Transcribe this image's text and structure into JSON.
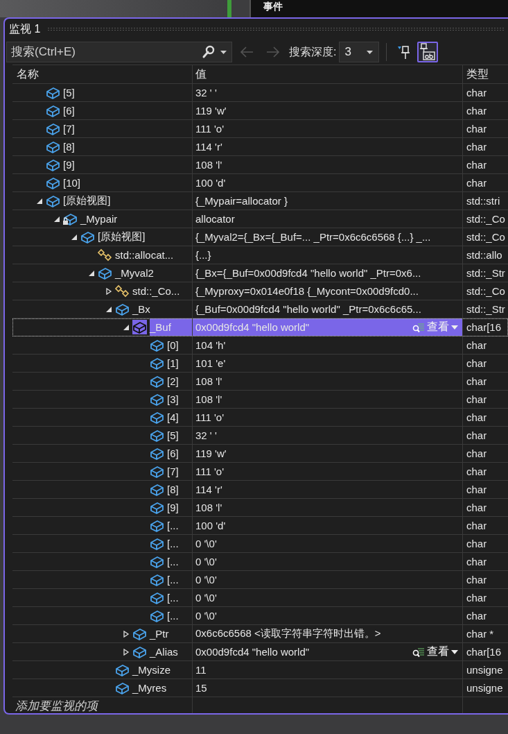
{
  "background_panel": {
    "title": "事件"
  },
  "window": {
    "title": "监视 1"
  },
  "toolbar": {
    "search": {
      "placeholder": "搜索(Ctrl+E)"
    },
    "back_disabled": true,
    "forward_disabled": true,
    "depth_label": "搜索深度:",
    "depth_value": "3",
    "pin_selected": false,
    "visualize_selected": true
  },
  "columns": [
    "名称",
    "值",
    "类型"
  ],
  "rows": [
    {
      "name": "[5]",
      "value": "32 ' '",
      "type": "char",
      "kind": "field",
      "selected": false
    },
    {
      "name": "[6]",
      "value": "119 'w'",
      "type": "char",
      "kind": "field",
      "selected": false
    },
    {
      "name": "[7]",
      "value": "111 'o'",
      "type": "char",
      "kind": "field",
      "selected": false
    },
    {
      "name": "[8]",
      "value": "114 'r'",
      "type": "char",
      "kind": "field",
      "selected": false
    },
    {
      "name": "[9]",
      "value": "108 'l'",
      "type": "char",
      "kind": "field",
      "selected": false
    },
    {
      "name": "[10]",
      "value": "100 'd'",
      "type": "char",
      "kind": "field",
      "selected": false
    },
    {
      "name": "[原始视图]",
      "value": "{_Mypair=allocator }",
      "type": "std::stri",
      "kind": "field",
      "selected": false,
      "expanded": true,
      "children": [
        {
          "name": "_Mypair",
          "value": "allocator",
          "type": "std::_Co",
          "kind": "private_field",
          "selected": false,
          "expanded": true,
          "children": [
            {
              "name": "[原始视图]",
              "value": "{_Myval2={_Bx={_Buf=... _Ptr=0x6c6c6568 {...} _...",
              "type": "std::_Co",
              "kind": "field",
              "selected": false,
              "expanded": true,
              "children": [
                {
                  "name": "std::allocat...",
                  "value": "{...}",
                  "type": "std::allo",
                  "kind": "base_class",
                  "selected": false
                },
                {
                  "name": "_Myval2",
                  "value": "{_Bx={_Buf=0x00d9fcd4 \"hello world\" _Ptr=0x6...",
                  "type": "std::_Str",
                  "kind": "field",
                  "selected": false,
                  "expanded": true,
                  "children": [
                    {
                      "name": "std::_Co...",
                      "value": "{_Myproxy=0x014e0f18 {_Mycont=0x00d9fcd0...",
                      "type": "std::_Co",
                      "kind": "base_class",
                      "selected": false,
                      "expanded": false
                    },
                    {
                      "name": "_Bx",
                      "value": "{_Buf=0x00d9fcd4 \"hello world\" _Ptr=0x6c6c65...",
                      "type": "std::_Str",
                      "kind": "field",
                      "selected": false,
                      "expanded": true,
                      "children": [
                        {
                          "name": "_Buf",
                          "value": "0x00d9fcd4 \"hello world\"",
                          "type": "char[16",
                          "kind": "field",
                          "selected": true,
                          "visualizer": "查看",
                          "expanded": true,
                          "children": [
                            {
                              "name": "[0]",
                              "value": "104 'h'",
                              "type": "char",
                              "kind": "field",
                              "selected": false
                            },
                            {
                              "name": "[1]",
                              "value": "101 'e'",
                              "type": "char",
                              "kind": "field",
                              "selected": false
                            },
                            {
                              "name": "[2]",
                              "value": "108 'l'",
                              "type": "char",
                              "kind": "field",
                              "selected": false
                            },
                            {
                              "name": "[3]",
                              "value": "108 'l'",
                              "type": "char",
                              "kind": "field",
                              "selected": false
                            },
                            {
                              "name": "[4]",
                              "value": "111 'o'",
                              "type": "char",
                              "kind": "field",
                              "selected": false
                            },
                            {
                              "name": "[5]",
                              "value": "32 ' '",
                              "type": "char",
                              "kind": "field",
                              "selected": false
                            },
                            {
                              "name": "[6]",
                              "value": "119 'w'",
                              "type": "char",
                              "kind": "field",
                              "selected": false
                            },
                            {
                              "name": "[7]",
                              "value": "111 'o'",
                              "type": "char",
                              "kind": "field",
                              "selected": false
                            },
                            {
                              "name": "[8]",
                              "value": "114 'r'",
                              "type": "char",
                              "kind": "field",
                              "selected": false
                            },
                            {
                              "name": "[9]",
                              "value": "108 'l'",
                              "type": "char",
                              "kind": "field",
                              "selected": false
                            },
                            {
                              "name": "[...",
                              "value": "100 'd'",
                              "type": "char",
                              "kind": "field",
                              "selected": false
                            },
                            {
                              "name": "[...",
                              "value": "0 '\\0'",
                              "type": "char",
                              "kind": "field",
                              "selected": false
                            },
                            {
                              "name": "[...",
                              "value": "0 '\\0'",
                              "type": "char",
                              "kind": "field",
                              "selected": false
                            },
                            {
                              "name": "[...",
                              "value": "0 '\\0'",
                              "type": "char",
                              "kind": "field",
                              "selected": false
                            },
                            {
                              "name": "[...",
                              "value": "0 '\\0'",
                              "type": "char",
                              "kind": "field",
                              "selected": false
                            },
                            {
                              "name": "[...",
                              "value": "0 '\\0'",
                              "type": "char",
                              "kind": "field",
                              "selected": false
                            }
                          ]
                        },
                        {
                          "name": "_Ptr",
                          "value": "0x6c6c6568 <读取字符串字符时出错。>",
                          "type": "char *",
                          "kind": "field",
                          "selected": false,
                          "expanded": false
                        },
                        {
                          "name": "_Alias",
                          "value": "0x00d9fcd4 \"hello world\"",
                          "type": "char[16",
                          "kind": "field",
                          "selected": false,
                          "visualizer": "查看",
                          "expanded": false
                        }
                      ]
                    },
                    {
                      "name": "_Mysize",
                      "value": "11",
                      "type": "unsigne",
                      "kind": "field",
                      "selected": false
                    },
                    {
                      "name": "_Myres",
                      "value": "15",
                      "type": "unsigne",
                      "kind": "field",
                      "selected": false
                    }
                  ]
                }
              ]
            }
          ]
        }
      ]
    }
  ],
  "add_watch": {
    "placeholder": "添加要监视的项"
  }
}
